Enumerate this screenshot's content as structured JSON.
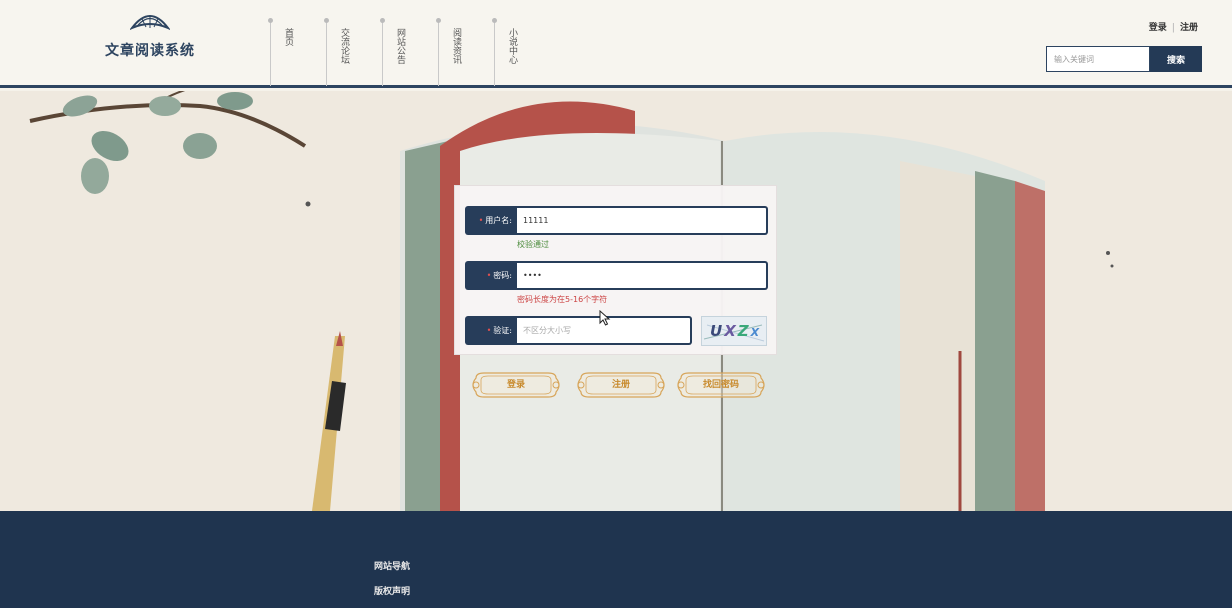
{
  "header": {
    "app_title": "文章阅读系统",
    "nav": [
      {
        "label": "首页"
      },
      {
        "label": "交流论坛"
      },
      {
        "label": "网站公告"
      },
      {
        "label": "阅读资讯"
      },
      {
        "label": "小说中心"
      }
    ],
    "login_link": "登录",
    "register_link": "注册",
    "search": {
      "placeholder": "输入关键词",
      "value": "",
      "button_label": "搜索"
    }
  },
  "login_form": {
    "username": {
      "label": "用户名:",
      "value": "11111",
      "hint": "校验通过"
    },
    "password": {
      "label": "密码:",
      "value": "••••",
      "hint": "密码长度为在5-16个字符"
    },
    "captcha": {
      "label": "验证:",
      "placeholder": "不区分大小写",
      "value": "",
      "code": "UXZX"
    }
  },
  "actions": {
    "login_label": "登录",
    "register_label": "注册",
    "recover_label": "找回密码"
  },
  "footer": {
    "nav_link": "网站导航",
    "copyright_link": "版权声明"
  },
  "colors": {
    "primary": "#273d5a",
    "accent_gold": "#c88a2c",
    "ok": "#4a8a3a",
    "error": "#cc4444"
  }
}
